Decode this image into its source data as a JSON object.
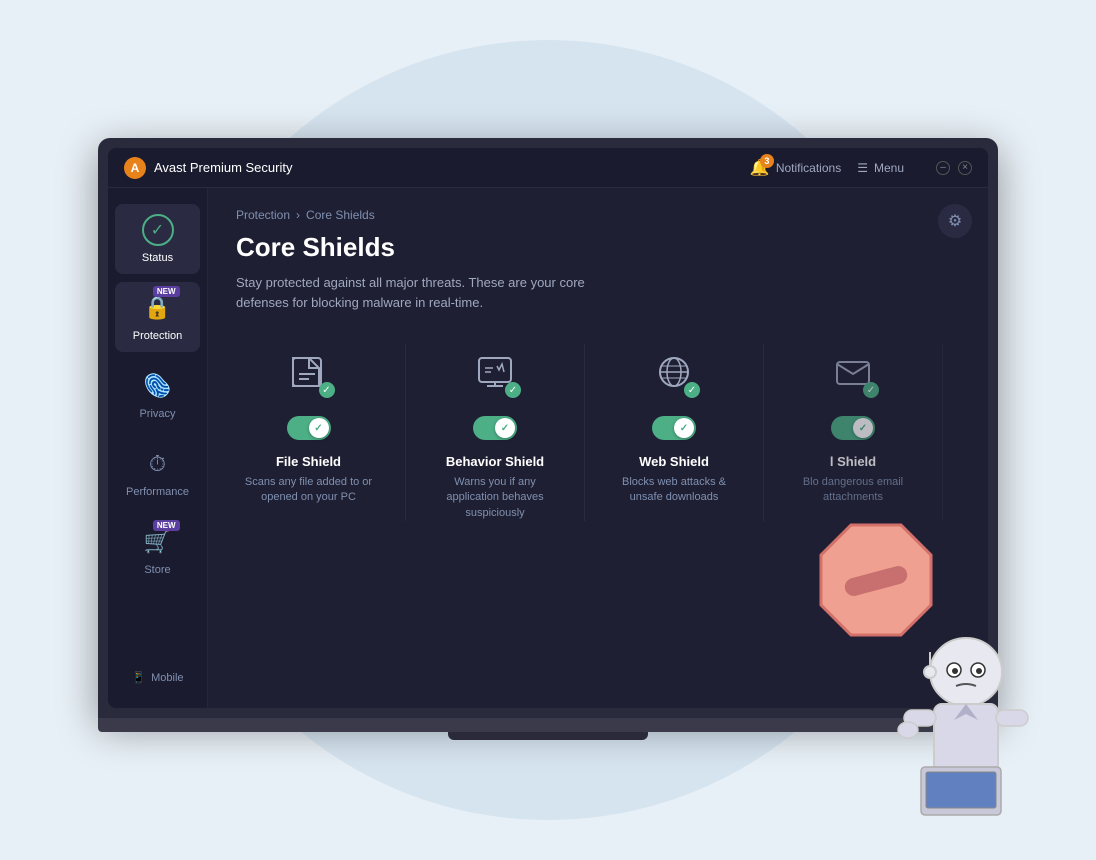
{
  "app": {
    "logo_letter": "A",
    "title": "Avast Premium Security"
  },
  "titlebar": {
    "notifications_label": "Notifications",
    "notifications_count": "3",
    "menu_label": "Menu",
    "minimize_label": "–",
    "close_label": "×"
  },
  "sidebar": {
    "items": [
      {
        "id": "status",
        "label": "Status",
        "icon": "check-circle",
        "active": true,
        "new_badge": false
      },
      {
        "id": "protection",
        "label": "Protection",
        "icon": "lock",
        "active": false,
        "new_badge": true
      },
      {
        "id": "privacy",
        "label": "Privacy",
        "icon": "fingerprint",
        "active": false,
        "new_badge": false
      },
      {
        "id": "performance",
        "label": "Performance",
        "icon": "speedometer",
        "active": false,
        "new_badge": false
      },
      {
        "id": "store",
        "label": "Store",
        "icon": "cart",
        "active": false,
        "new_badge": true
      }
    ],
    "mobile_label": "Mobile"
  },
  "breadcrumb": {
    "parent": "Protection",
    "separator": "›",
    "current": "Core Shields"
  },
  "content": {
    "title": "Core Shields",
    "description": "Stay protected against all major threats. These are your core defenses for blocking malware in real-time."
  },
  "shields": [
    {
      "name": "File Shield",
      "description": "Scans any file added to or opened on your PC",
      "enabled": true,
      "icon": "folder"
    },
    {
      "name": "Behavior Shield",
      "description": "Warns you if any application behaves suspiciously",
      "enabled": true,
      "icon": "behavior"
    },
    {
      "name": "Web Shield",
      "description": "Blocks web attacks & unsafe downloads",
      "enabled": true,
      "icon": "web"
    },
    {
      "name": "Mail Shield",
      "description": "Blocks dangerous email attachments",
      "enabled": true,
      "icon": "mail"
    }
  ],
  "colors": {
    "accent_green": "#4caf86",
    "accent_orange": "#e8821a",
    "accent_purple": "#5b3fa0",
    "bg_dark": "#1a1b2e",
    "bg_medium": "#1e1f32",
    "text_primary": "#ffffff",
    "text_secondary": "#a0a8c0"
  }
}
